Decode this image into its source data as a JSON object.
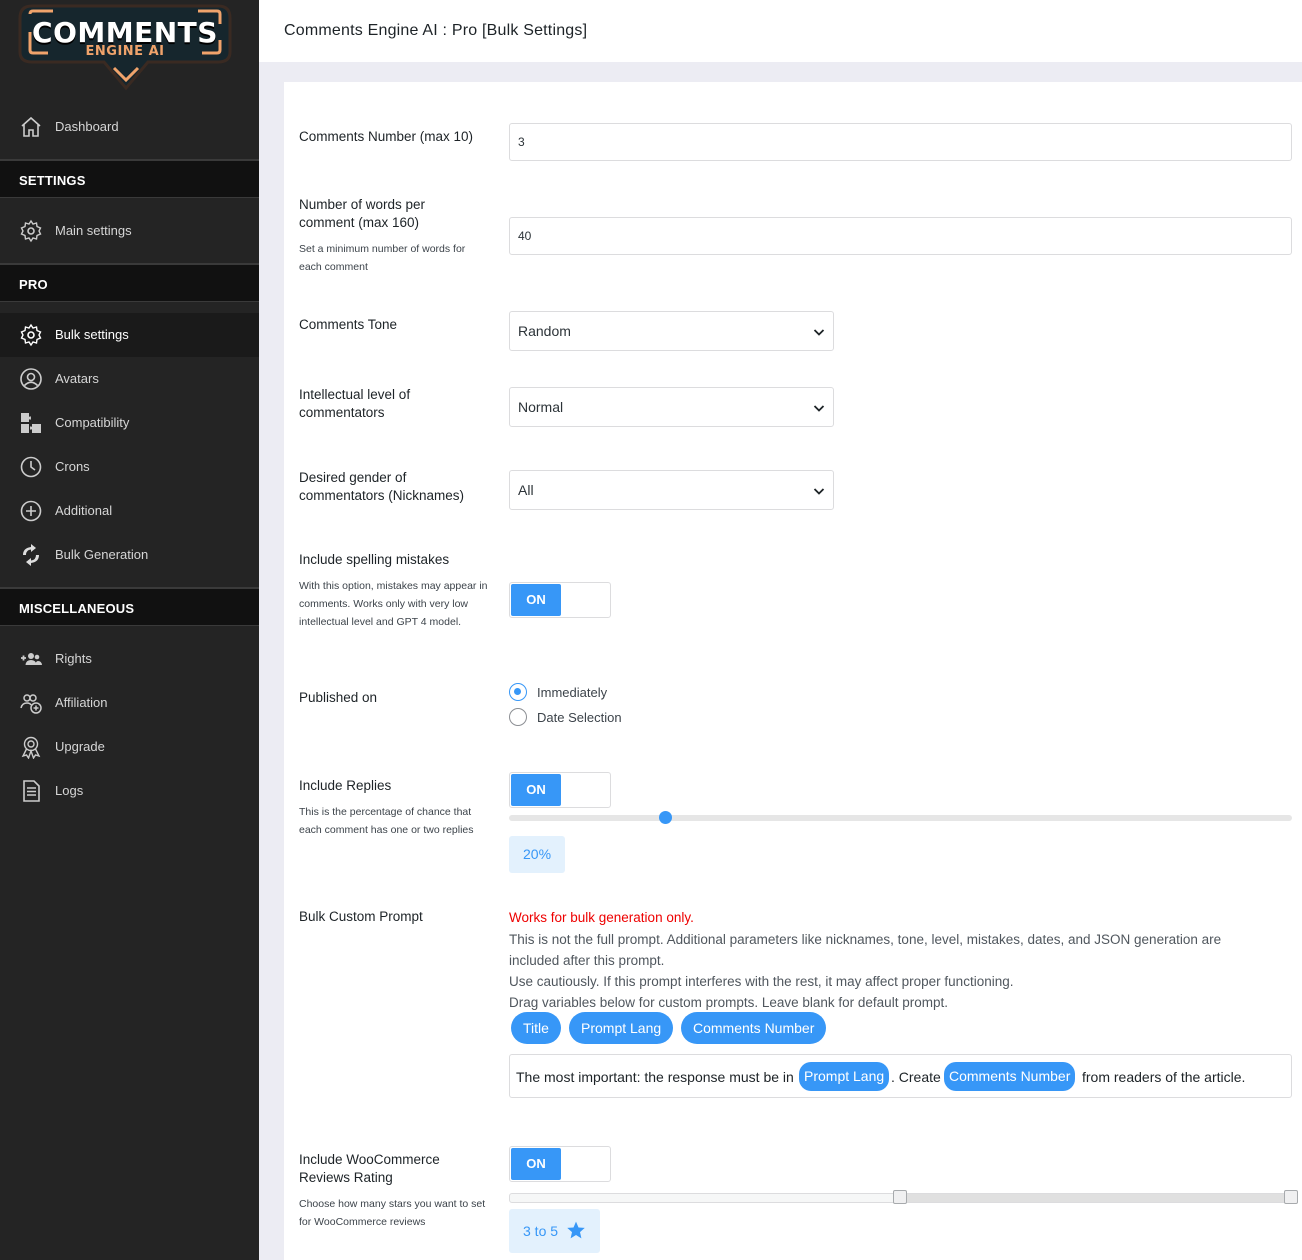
{
  "header": {
    "title": "Comments Engine AI : Pro [Bulk Settings]"
  },
  "logo": {
    "line1": "COMMENTS",
    "line2": "ENGINE AI"
  },
  "sidebar": {
    "dashboard": "Dashboard",
    "settings_heading": "SETTINGS",
    "main_settings": "Main settings",
    "pro_heading": "PRO",
    "bulk_settings": "Bulk settings",
    "avatars": "Avatars",
    "compatibility": "Compatibility",
    "crons": "Crons",
    "additional": "Additional",
    "bulk_generation": "Bulk Generation",
    "misc_heading": "MISCELLANEOUS",
    "rights": "Rights",
    "affiliation": "Affiliation",
    "upgrade": "Upgrade",
    "logs": "Logs"
  },
  "form": {
    "comments_number": {
      "label": "Comments Number (max 10)",
      "value": "3"
    },
    "words_per_comment": {
      "label": "Number of words per comment (max 160)",
      "help": "Set a minimum number of words for each comment",
      "value": "40"
    },
    "tone": {
      "label": "Comments Tone",
      "value": "Random"
    },
    "intellectual_level": {
      "label": "Intellectual level of commentators",
      "value": "Normal"
    },
    "gender": {
      "label": "Desired gender of commentators (Nicknames)",
      "value": "All"
    },
    "spelling": {
      "label": "Include spelling mistakes",
      "help": "With this option, mistakes may appear in comments. Works only with very low intellectual level and GPT 4 model.",
      "toggle": "ON"
    },
    "published": {
      "label": "Published on",
      "option1": "Immediately",
      "option2": "Date Selection"
    },
    "replies": {
      "label": "Include Replies",
      "help": "This is the percentage of chance that each comment has one or two replies",
      "toggle": "ON",
      "percent": 0.2,
      "value_text": "20%"
    },
    "prompt": {
      "label": "Bulk Custom Prompt",
      "warning": "Works for bulk generation only.",
      "note1": "This is not the full prompt. Additional parameters like nicknames, tone, level, mistakes, dates, and JSON generation are included after this prompt.",
      "note2": "Use cautiously. If this prompt interferes with the rest, it may affect proper functioning.",
      "note3": "Drag variables below for custom prompts. Leave blank for default prompt.",
      "chips": [
        "Title",
        "Prompt Lang",
        "Comments Number"
      ],
      "text_part1": "The most important: the response must be in",
      "chip_a": "Prompt Lang",
      "text_part2": ". Create",
      "chip_b": "Comments Number",
      "text_part3": "from readers of the article."
    },
    "woo": {
      "label": "Include WooCommerce Reviews Rating",
      "help": "Choose how many stars you want to set for WooCommerce reviews",
      "toggle": "ON",
      "range": [
        3,
        5
      ],
      "value_text": "3 to 5"
    }
  },
  "colors": {
    "accent": "#3797f7",
    "sidebar": "#242424",
    "warning": "#ee0000"
  }
}
